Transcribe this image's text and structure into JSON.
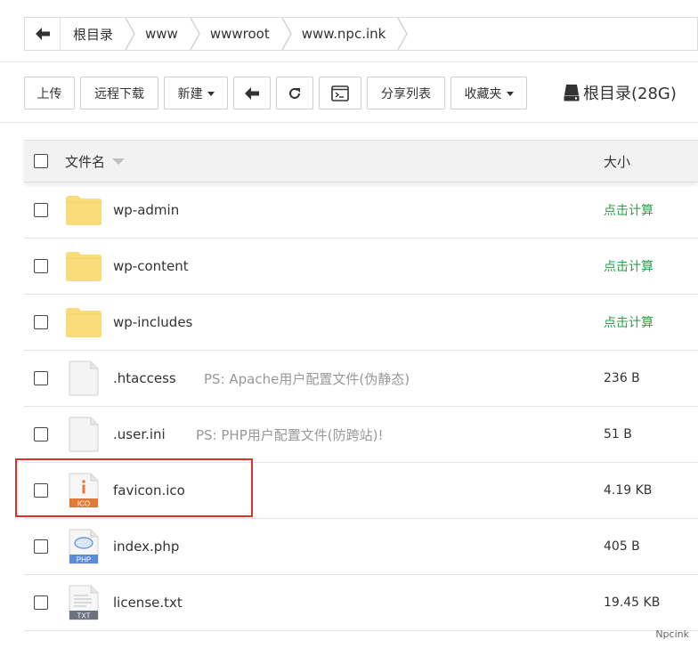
{
  "breadcrumb": {
    "items": [
      "根目录",
      "www",
      "wwwroot",
      "www.npc.ink"
    ]
  },
  "toolbar": {
    "upload": "上传",
    "remote_download": "远程下载",
    "new": "新建",
    "share_list": "分享列表",
    "favorites": "收藏夹",
    "disk_label": "根目录(28G)"
  },
  "table": {
    "col_name": "文件名",
    "col_size": "大小",
    "rows": [
      {
        "name": "wp-admin",
        "ps": "",
        "size": "点击计算",
        "type": "folder"
      },
      {
        "name": "wp-content",
        "ps": "",
        "size": "点击计算",
        "type": "folder"
      },
      {
        "name": "wp-includes",
        "ps": "",
        "size": "点击计算",
        "type": "folder"
      },
      {
        "name": ".htaccess",
        "ps": "PS: Apache用户配置文件(伪静态)",
        "size": "236 B",
        "type": "file"
      },
      {
        "name": ".user.ini",
        "ps": "PS: PHP用户配置文件(防跨站)!",
        "size": "51 B",
        "type": "file"
      },
      {
        "name": "favicon.ico",
        "ps": "",
        "size": "4.19 KB",
        "type": "ico",
        "badge": "ICO"
      },
      {
        "name": "index.php",
        "ps": "",
        "size": "405 B",
        "type": "php",
        "badge": "PHP"
      },
      {
        "name": "license.txt",
        "ps": "",
        "size": "19.45 KB",
        "type": "txt",
        "badge": "TXT"
      }
    ]
  },
  "watermark": "Npcink",
  "colors": {
    "calc_green": "#2aa146",
    "highlight_red": "#d9342b",
    "folder_yellow": "#fbdc7c",
    "ico_orange": "#e07a3a",
    "php_blue": "#5b8dd6",
    "txt_gray": "#6b7280"
  },
  "icons": {
    "back": "arrow-left-icon",
    "refresh": "refresh-icon",
    "terminal": "terminal-icon",
    "disk": "hard-drive-icon"
  }
}
